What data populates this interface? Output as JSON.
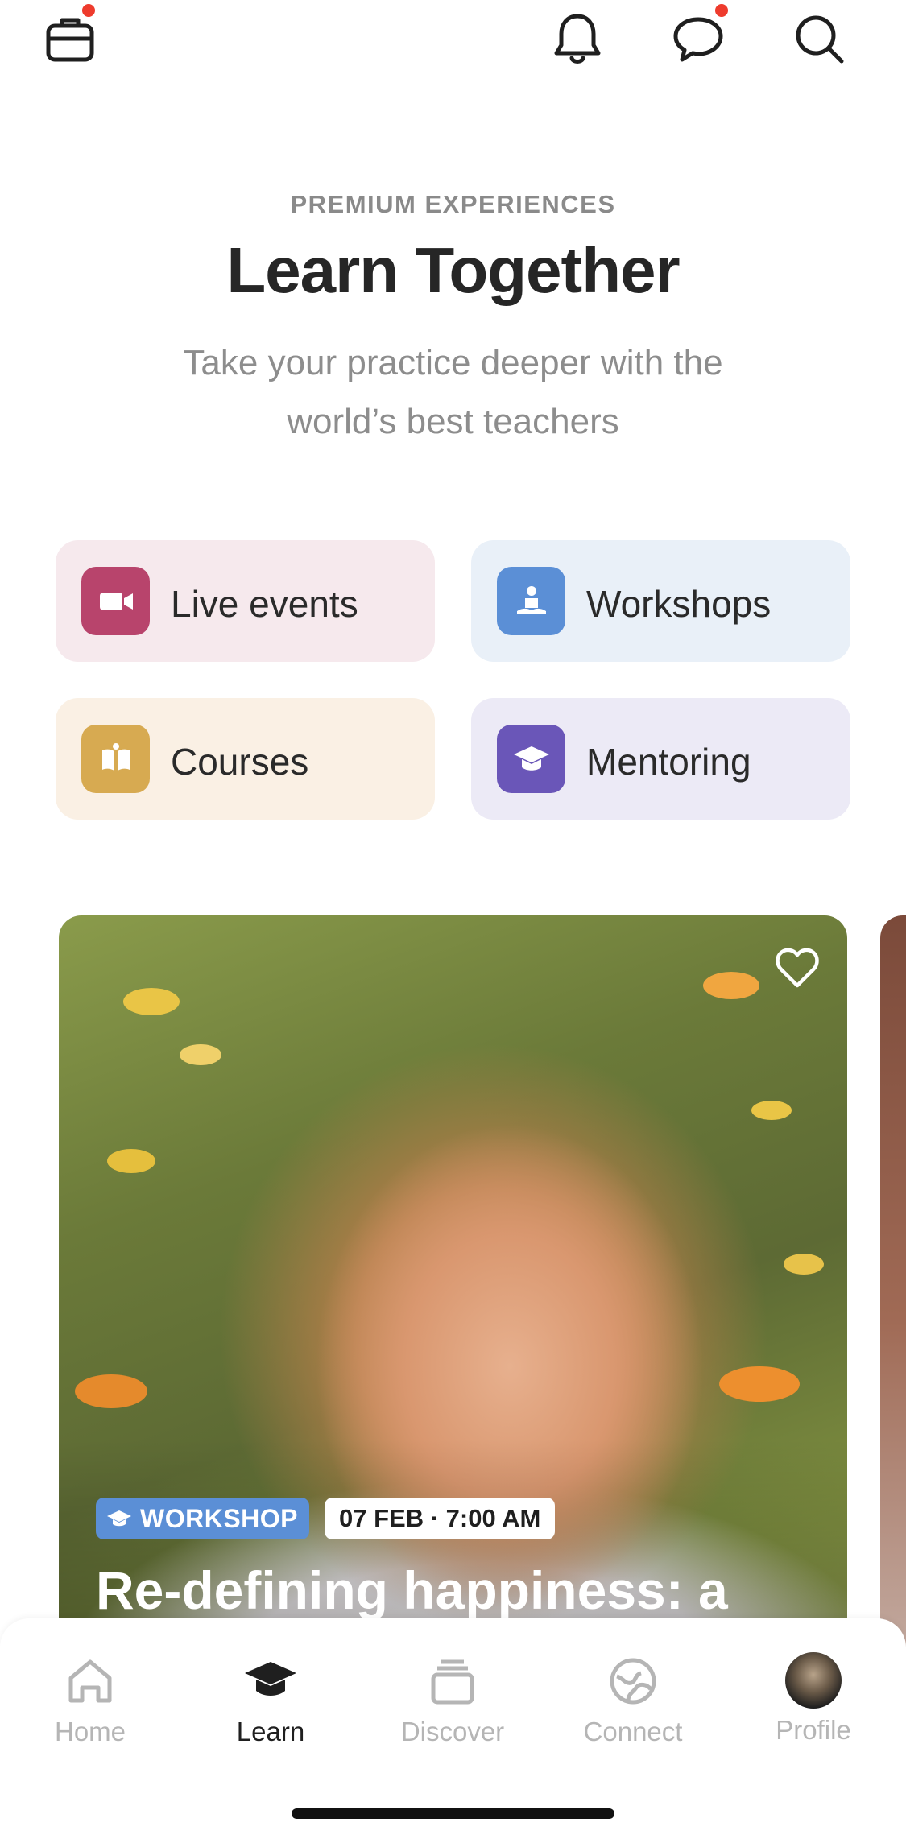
{
  "hero": {
    "eyebrow": "PREMIUM EXPERIENCES",
    "title": "Learn Together",
    "subtitle": "Take your practice deeper with the world’s best teachers"
  },
  "categories": [
    {
      "label": "Live events",
      "icon": "video-camera-icon",
      "bg": "#f6e9ed",
      "icon_bg": "#b8446c"
    },
    {
      "label": "Workshops",
      "icon": "meditation-icon",
      "bg": "#e9f0f8",
      "icon_bg": "#5b8fd6"
    },
    {
      "label": "Courses",
      "icon": "book-icon",
      "bg": "#faf0e4",
      "icon_bg": "#d7aa51"
    },
    {
      "label": "Mentoring",
      "icon": "graduation-cap-icon",
      "bg": "#eceaf6",
      "icon_bg": "#6a56b8"
    }
  ],
  "featured": {
    "type_label": "WORKSHOP",
    "date_label": "07 FEB · 7:00 AM",
    "title": "Re-defining happiness: a"
  },
  "nav": {
    "items": [
      {
        "label": "Home",
        "icon": "home-icon"
      },
      {
        "label": "Learn",
        "icon": "graduation-cap-icon"
      },
      {
        "label": "Discover",
        "icon": "stack-icon"
      },
      {
        "label": "Connect",
        "icon": "globe-icon"
      },
      {
        "label": "Profile",
        "icon": "avatar"
      }
    ],
    "active": "Learn"
  },
  "colors": {
    "notification_dot": "#ee3b2d",
    "workshop_badge": "#5b8fd6"
  }
}
